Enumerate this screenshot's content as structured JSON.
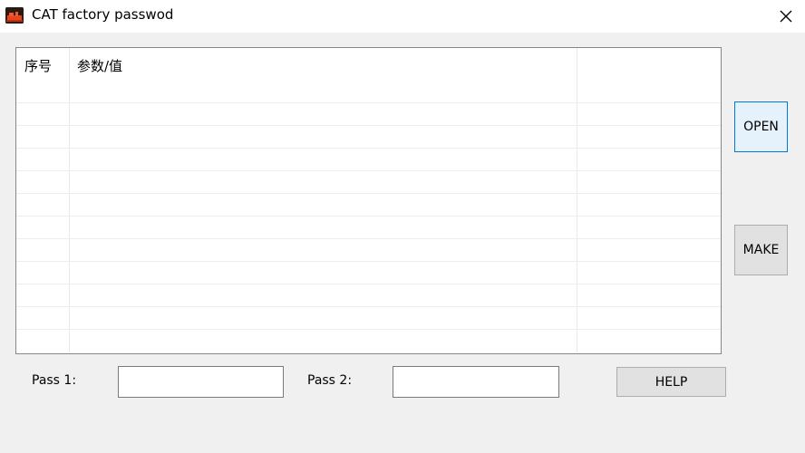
{
  "window": {
    "title": "CAT factory passwod",
    "icon": "app-icon",
    "close_icon": "close-icon"
  },
  "listview": {
    "columns": [
      "序号",
      "参数/值",
      ""
    ],
    "rows": []
  },
  "buttons": {
    "open": "OPEN",
    "make": "MAKE",
    "help": "HELP"
  },
  "fields": {
    "pass1": {
      "label": "Pass 1:",
      "value": ""
    },
    "pass2": {
      "label": "Pass 2:",
      "value": ""
    }
  },
  "colors": {
    "focus_accent": "#0078d7",
    "button_face": "#e1e1e1",
    "window_bg": "#f0f0f0"
  }
}
